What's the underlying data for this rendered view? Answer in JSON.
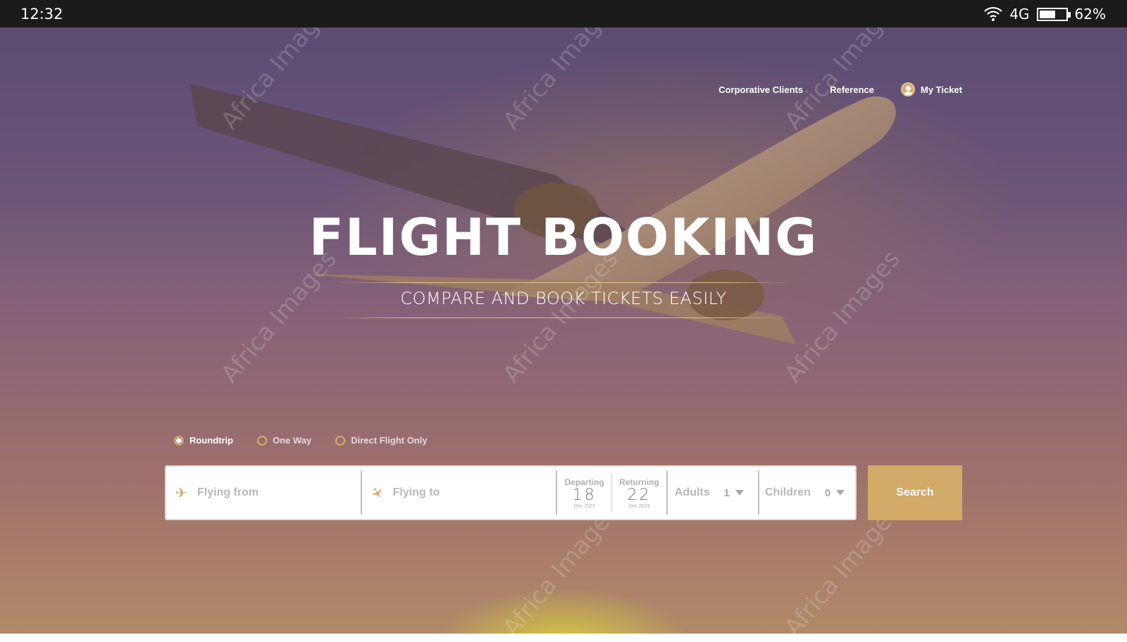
{
  "statusbar": {
    "time": "12:32",
    "network": "4G",
    "battery_percent": "62%",
    "battery_level": 0.62,
    "icons": [
      "wifi-icon",
      "battery-icon"
    ]
  },
  "nav": {
    "items": [
      {
        "label": "Corporative Clients"
      },
      {
        "label": "Reference"
      },
      {
        "label": "My Ticket",
        "icon": "user-avatar-icon"
      }
    ]
  },
  "hero": {
    "title": "FLIGHT BOOKING",
    "subtitle": "COMPARE AND BOOK TICKETS EASILY"
  },
  "trip_options": [
    {
      "label": "Roundtrip",
      "selected": true
    },
    {
      "label": "One Way",
      "selected": false
    },
    {
      "label": "Direct Flight Only",
      "selected": false
    }
  ],
  "form": {
    "from": {
      "placeholder": "Flying from",
      "icon": "takeoff-icon"
    },
    "to": {
      "placeholder": "Flying to",
      "icon": "landing-icon"
    },
    "departing": {
      "label": "Departing",
      "day": "18",
      "month": "Dec 2023"
    },
    "returning": {
      "label": "Returning",
      "day": "22",
      "month": "Dec 2023"
    },
    "adults": {
      "label": "Adults",
      "value": "1"
    },
    "children": {
      "label": "Children",
      "value": "0"
    },
    "search_label": "Search"
  },
  "colors": {
    "accent": "#d0aa66",
    "statusbar": "#1b1b1b"
  },
  "watermark": "Africa Images"
}
